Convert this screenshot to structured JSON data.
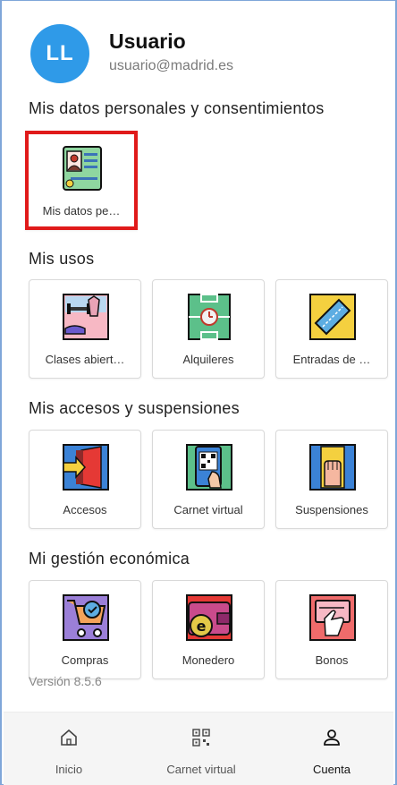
{
  "user": {
    "initials": "LL",
    "name": "Usuario",
    "email": "usuario@madrid.es"
  },
  "sections": {
    "personal": {
      "title": "Mis datos personales y consentimientos",
      "items": [
        {
          "label": "Mis datos pe…",
          "icon": "personal-data-icon"
        }
      ]
    },
    "usos": {
      "title": "Mis usos",
      "items": [
        {
          "label": "Clases abiert…",
          "icon": "classes-icon"
        },
        {
          "label": "Alquileres",
          "icon": "rentals-icon"
        },
        {
          "label": "Entradas de …",
          "icon": "ticket-icon"
        }
      ]
    },
    "accesos": {
      "title": "Mis accesos y suspensiones",
      "items": [
        {
          "label": "Accesos",
          "icon": "access-door-icon"
        },
        {
          "label": "Carnet virtual",
          "icon": "virtual-card-icon"
        },
        {
          "label": "Suspensiones",
          "icon": "suspension-icon"
        }
      ]
    },
    "economica": {
      "title": "Mi gestión económica",
      "items": [
        {
          "label": "Compras",
          "icon": "shopping-cart-icon"
        },
        {
          "label": "Monedero",
          "icon": "wallet-icon"
        },
        {
          "label": "Bonos",
          "icon": "voucher-icon"
        }
      ]
    }
  },
  "version": "Versión 8.5.6",
  "nav": {
    "items": [
      {
        "label": "Inicio",
        "icon": "home-icon"
      },
      {
        "label": "Carnet virtual",
        "icon": "qr-code-icon"
      },
      {
        "label": "Cuenta",
        "icon": "account-icon"
      }
    ],
    "active": "Cuenta"
  },
  "colors": {
    "avatar": "#2f9ae8",
    "highlight": "#e01a1a",
    "frame": "#7fa6d9"
  }
}
